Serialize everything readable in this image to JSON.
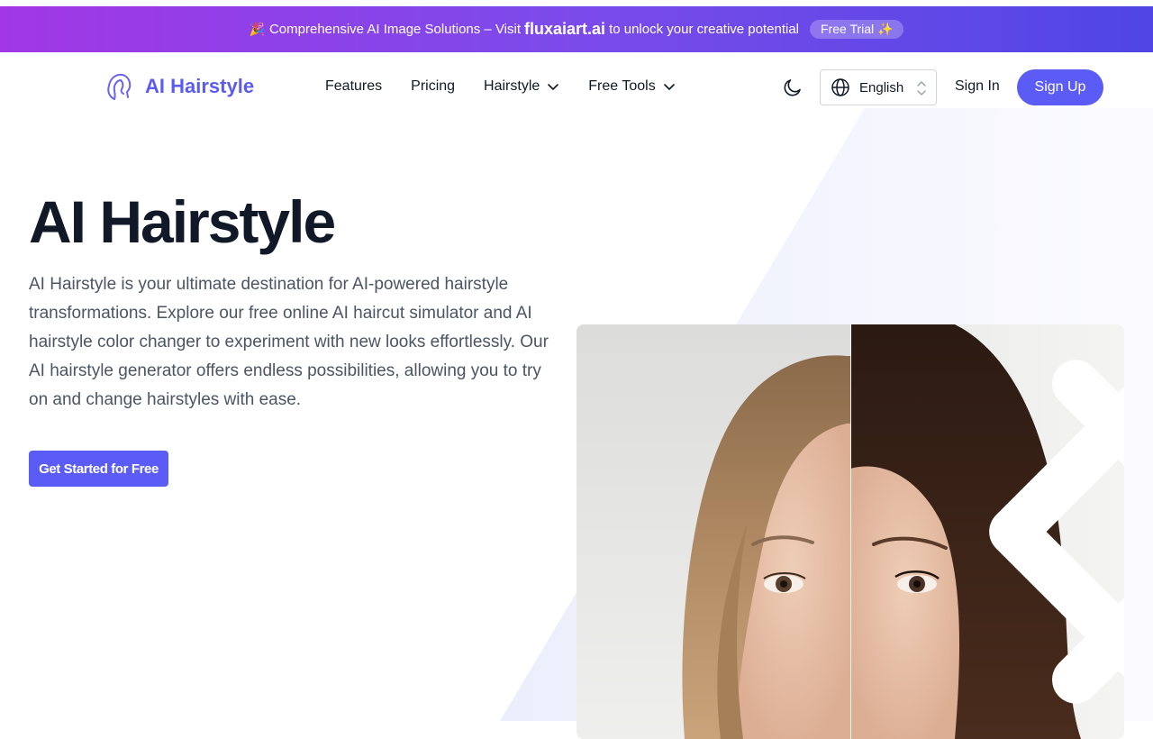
{
  "promo": {
    "emoji": "🎉",
    "text_before": "Comprehensive AI Image Solutions – Visit",
    "brand": "fluxaiart.ai",
    "text_after": "to unlock your creative potential",
    "trial_label": "Free Trial ✨",
    "gradient_start": "#a137e6",
    "gradient_end": "#4f46e5"
  },
  "header": {
    "logo_text": "AI Hairstyle",
    "logo_icon": "hair-profile-icon",
    "nav": [
      {
        "label": "Features"
      },
      {
        "label": "Pricing"
      },
      {
        "label": "Hairstyle",
        "dropdown": true
      },
      {
        "label": "Free Tools",
        "dropdown": true
      }
    ],
    "theme_icon": "moon-icon",
    "language": "English",
    "sign_in": "Sign In",
    "sign_up": "Sign Up",
    "accent_color": "#5b5bf5"
  },
  "hero": {
    "title": "AI Hairstyle",
    "description": "AI Hairstyle is your ultimate destination for AI-powered hairstyle transformations. Explore our free online AI haircut simulator and AI hairstyle color changer to experiment with new looks effortlessly. Our AI hairstyle generator offers endless possibilities, allowing you to try on and change hairstyles with ease.",
    "cta": "Get Started for Free"
  },
  "comparison": {
    "slider_position": 0.5,
    "left_icon": "chevron-left-icon",
    "right_icon": "chevron-right-icon"
  }
}
